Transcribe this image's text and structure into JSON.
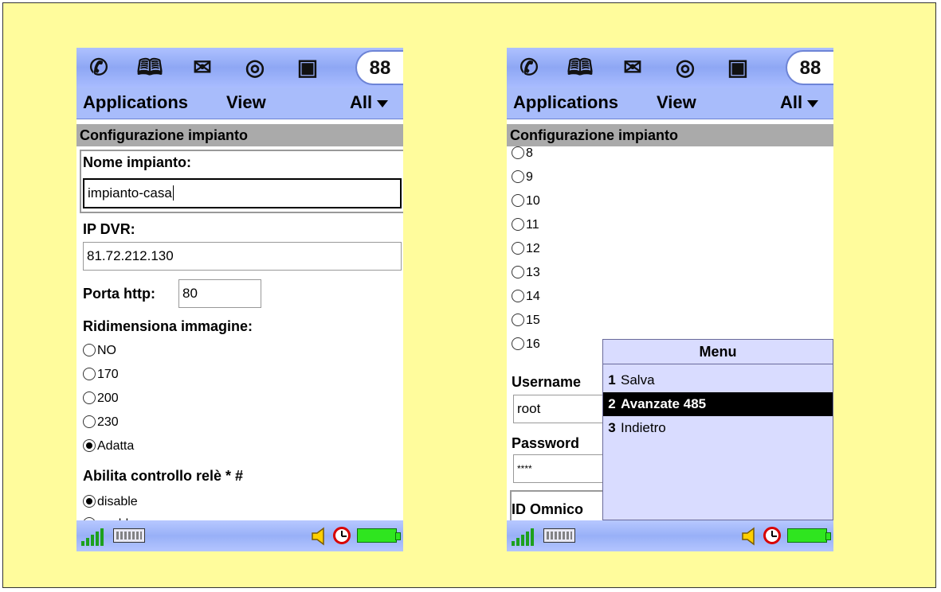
{
  "toolbar": {
    "icons": [
      "phone-icon",
      "contacts-book-icon",
      "mail-icon",
      "web-globe-icon",
      "calendar-icon",
      "applications-icon"
    ],
    "apps_glyph": "88"
  },
  "menubar": {
    "applications": "Applications",
    "view": "View",
    "filter": "All"
  },
  "left": {
    "section_title": "Configurazione impianto",
    "nome_label": "Nome impianto:",
    "nome_value": "impianto-casa",
    "ip_label": "IP DVR:",
    "ip_value": "81.72.212.130",
    "porta_label": "Porta http:",
    "porta_value": "80",
    "ridim_label": "Ridimensiona immagine:",
    "ridim_options": [
      "NO",
      "170",
      "200",
      "230",
      "Adatta"
    ],
    "ridim_selected": "Adatta",
    "rele_label": "Abilita controllo relè * #",
    "rele_options": [
      "disable",
      "enable"
    ],
    "rele_selected": "disable"
  },
  "right": {
    "section_title": "Configurazione impianto",
    "radio_options": [
      "8",
      "9",
      "10",
      "11",
      "12",
      "13",
      "14",
      "15",
      "16"
    ],
    "username_label": "Username",
    "username_value": "root",
    "password_label": "Password",
    "password_value": "****",
    "id_label": "ID Omnico",
    "menu": {
      "title": "Menu",
      "items": [
        {
          "num": "1",
          "label": "Salva"
        },
        {
          "num": "2",
          "label": "Avanzate 485"
        },
        {
          "num": "3",
          "label": "Indietro"
        }
      ],
      "selected": "Avanzate 485"
    }
  },
  "colors": {
    "background": "#fffc9c",
    "toolbar": "#8ea7f4",
    "menubar": "#a8bcfb",
    "section_header": "#aaaaaa",
    "menu_popup": "#d9dcff",
    "battery": "#2fe51f",
    "clock": "#d80000"
  }
}
